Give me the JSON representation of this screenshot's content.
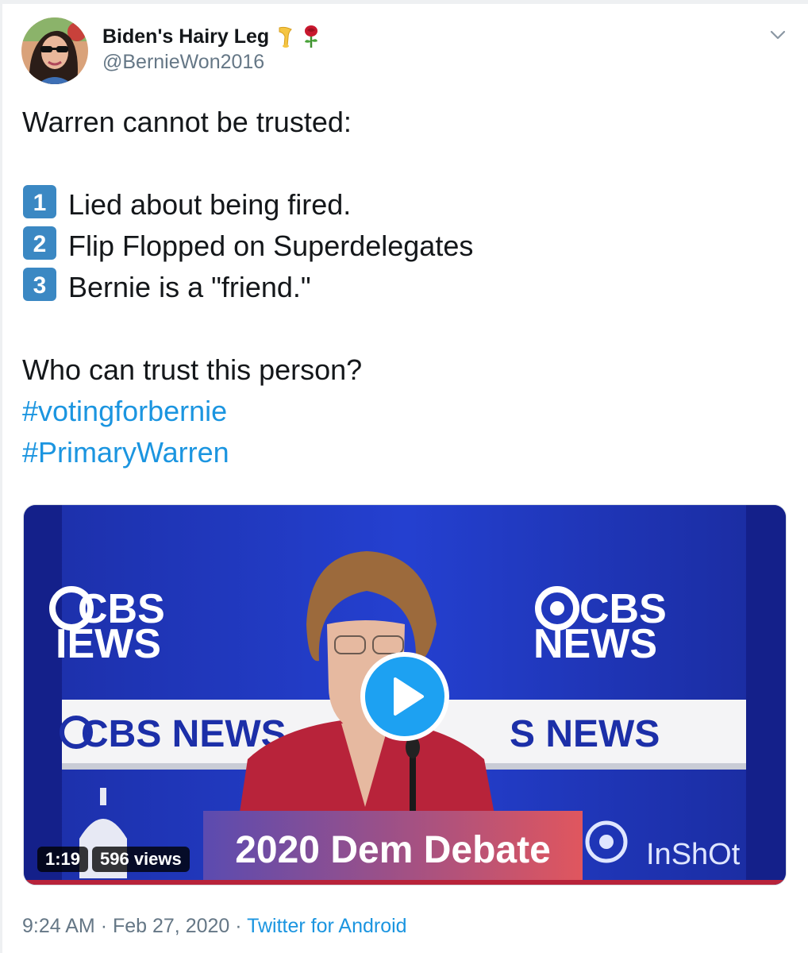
{
  "author": {
    "display_name": "Biden's Hairy Leg",
    "handle": "@BernieWon2016",
    "name_emojis": [
      "leg-icon",
      "rose-icon"
    ]
  },
  "tweet": {
    "intro": "Warren cannot be trusted:",
    "points": [
      {
        "number": "1",
        "text": "Lied about being fired."
      },
      {
        "number": "2",
        "text": "Flip Flopped on Superdelegates"
      },
      {
        "number": "3",
        "text": "Bernie is a \"friend.\""
      }
    ],
    "question": "Who can trust this person?",
    "hashtags": [
      "#votingforbernie",
      "#PrimaryWarren"
    ]
  },
  "video": {
    "duration": "1:19",
    "views": "596 views",
    "overlay_caption": "2020 Dem Debate",
    "watermark": "InShOt",
    "backdrop_text": {
      "logo_left_line1": "CBS",
      "logo_left_line2": "IEWS",
      "logo_right_line1": "CBS",
      "logo_right_line2": "NEWS",
      "banner_left": "CBS NEWS",
      "banner_right": "S NEWS"
    }
  },
  "meta": {
    "time": "9:24 AM",
    "separator": "·",
    "date": "Feb 27, 2020",
    "source": "Twitter for Android"
  },
  "colors": {
    "link": "#1b95e0",
    "text": "#14171a",
    "muted": "#657786",
    "play_button": "#1da1f2",
    "number_box": "#3b88c3"
  }
}
